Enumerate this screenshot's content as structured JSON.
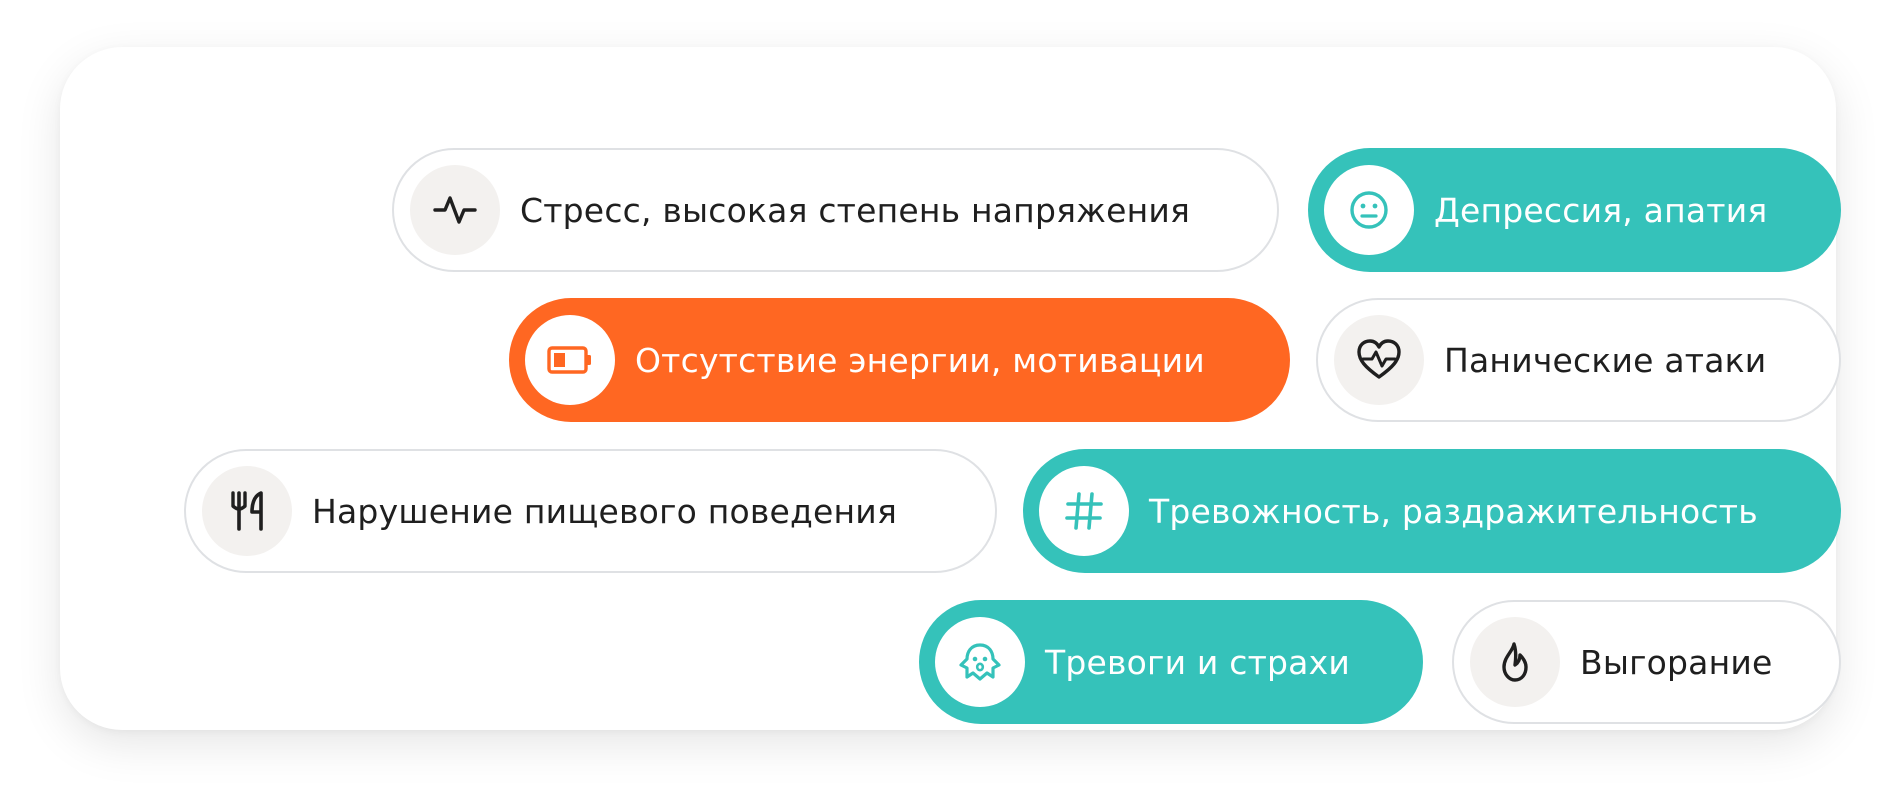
{
  "colors": {
    "teal": "#35c2ba",
    "orange": "#ff6722",
    "outline_border": "#dfe1e4",
    "icon_bg_neutral": "#f3f1ef",
    "text_dark": "#1f1f1f"
  },
  "chips": {
    "stress": {
      "label": "Стресс, высокая степень напряжения",
      "icon": "pulse-icon",
      "style": "outline"
    },
    "depression": {
      "label": "Депрессия, апатия",
      "icon": "neutral-face-icon",
      "style": "teal"
    },
    "energy": {
      "label": "Отсутствие энергии, мотивации",
      "icon": "low-battery-icon",
      "style": "orange"
    },
    "panic": {
      "label": "Панические атаки",
      "icon": "heart-pulse-icon",
      "style": "outline"
    },
    "eating": {
      "label": "Нарушение пищевого поведения",
      "icon": "fork-knife-icon",
      "style": "outline"
    },
    "anxiety": {
      "label": "Тревожность, раздражительность",
      "icon": "hashtag-icon",
      "style": "teal"
    },
    "fears": {
      "label": "Тревоги и страхи",
      "icon": "ghost-icon",
      "style": "teal"
    },
    "burnout": {
      "label": "Выгорание",
      "icon": "flame-icon",
      "style": "outline"
    }
  }
}
